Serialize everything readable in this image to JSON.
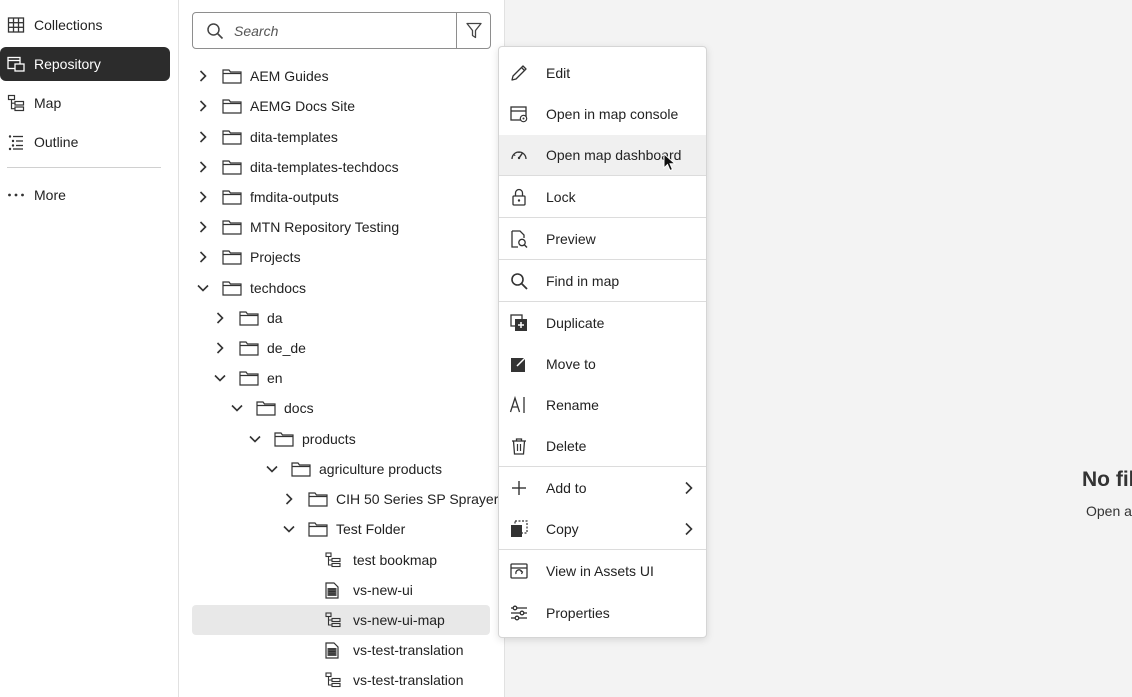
{
  "leftnav": {
    "items": [
      {
        "label": "Collections",
        "icon": "grid-icon"
      },
      {
        "label": "Repository",
        "icon": "repository-icon"
      },
      {
        "label": "Map",
        "icon": "map-icon"
      },
      {
        "label": "Outline",
        "icon": "outline-icon"
      }
    ],
    "more_label": "More"
  },
  "search": {
    "placeholder": "Search"
  },
  "tree": [
    {
      "label": "AEM Guides",
      "type": "folder",
      "expanded": false
    },
    {
      "label": "AEMG Docs Site",
      "type": "folder",
      "expanded": false
    },
    {
      "label": "dita-templates",
      "type": "folder",
      "expanded": false
    },
    {
      "label": "dita-templates-techdocs",
      "type": "folder",
      "expanded": false
    },
    {
      "label": "fmdita-outputs",
      "type": "folder",
      "expanded": false
    },
    {
      "label": "MTN Repository Testing",
      "type": "folder",
      "expanded": false
    },
    {
      "label": "Projects",
      "type": "folder",
      "expanded": false
    },
    {
      "label": "techdocs",
      "type": "folder",
      "expanded": true
    },
    {
      "label": "da",
      "type": "folder",
      "expanded": false
    },
    {
      "label": "de_de",
      "type": "folder",
      "expanded": false
    },
    {
      "label": "en",
      "type": "folder",
      "expanded": true
    },
    {
      "label": "docs",
      "type": "folder",
      "expanded": true
    },
    {
      "label": "products",
      "type": "folder",
      "expanded": true
    },
    {
      "label": "agriculture products",
      "type": "folder",
      "expanded": true
    },
    {
      "label": "CIH 50 Series SP Sprayer ...",
      "type": "folder",
      "expanded": false
    },
    {
      "label": "Test Folder",
      "type": "folder",
      "expanded": true
    },
    {
      "label": "test bookmap",
      "type": "map"
    },
    {
      "label": "vs-new-ui",
      "type": "topic"
    },
    {
      "label": "vs-new-ui-map",
      "type": "map",
      "selected": true
    },
    {
      "label": "vs-test-translation",
      "type": "topic"
    },
    {
      "label": "vs-test-translation",
      "type": "map"
    }
  ],
  "context_menu": {
    "items": [
      {
        "label": "Edit",
        "icon": "pencil-icon"
      },
      {
        "label": "Open in map console",
        "icon": "map-console-icon"
      },
      {
        "label": "Open map dashboard",
        "icon": "dashboard-icon"
      },
      {
        "label": "Lock",
        "icon": "lock-icon"
      },
      {
        "label": "Preview",
        "icon": "preview-icon"
      },
      {
        "label": "Find in map",
        "icon": "search-icon"
      },
      {
        "label": "Duplicate",
        "icon": "duplicate-icon"
      },
      {
        "label": "Move to",
        "icon": "move-icon"
      },
      {
        "label": "Rename",
        "icon": "rename-icon"
      },
      {
        "label": "Delete",
        "icon": "trash-icon"
      },
      {
        "label": "Add to",
        "icon": "plus-icon"
      },
      {
        "label": "Copy",
        "icon": "copy-icon"
      },
      {
        "label": "View in Assets UI",
        "icon": "assets-icon"
      },
      {
        "label": "Properties",
        "icon": "properties-icon"
      }
    ]
  },
  "empty_state": {
    "title": "No fil",
    "subtitle": "Open a"
  }
}
